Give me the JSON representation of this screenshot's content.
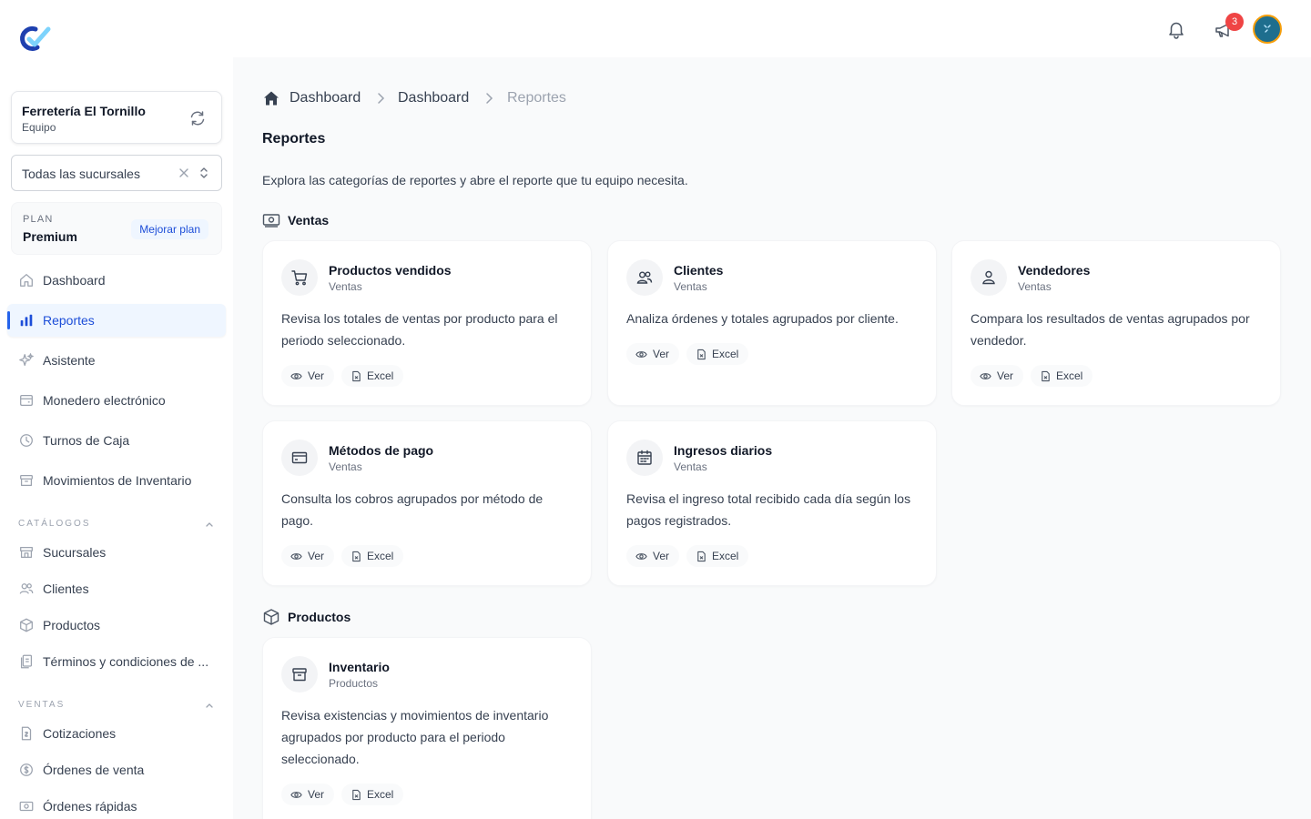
{
  "sidebar": {
    "org": {
      "name": "Ferretería El Tornillo",
      "role": "Equipo"
    },
    "branch": {
      "value": "Todas las sucursales"
    },
    "plan": {
      "label": "PLAN",
      "name": "Premium",
      "upgrade": "Mejorar plan"
    },
    "nav": [
      {
        "label": "Dashboard",
        "icon": "home-icon"
      },
      {
        "label": "Reportes",
        "icon": "bar-chart-icon",
        "active": true
      },
      {
        "label": "Asistente",
        "icon": "sparkles-icon"
      },
      {
        "label": "Monedero electrónico",
        "icon": "wallet-icon"
      },
      {
        "label": "Turnos de Caja",
        "icon": "clock-icon"
      },
      {
        "label": "Movimientos de Inventario",
        "icon": "archive-icon"
      }
    ],
    "sections": [
      {
        "title": "CATÁLOGOS",
        "items": [
          {
            "label": "Sucursales",
            "icon": "store-icon"
          },
          {
            "label": "Clientes",
            "icon": "users-icon"
          },
          {
            "label": "Productos",
            "icon": "cube-icon"
          },
          {
            "label": "Términos y condiciones de ...",
            "icon": "document-icon"
          }
        ]
      },
      {
        "title": "VENTAS",
        "items": [
          {
            "label": "Cotizaciones",
            "icon": "quote-document-icon"
          },
          {
            "label": "Órdenes de venta",
            "icon": "dollar-circle-icon"
          },
          {
            "label": "Órdenes rápidas",
            "icon": "banknote-icon"
          }
        ]
      }
    ]
  },
  "topbar": {
    "notification_count": "3"
  },
  "breadcrumb": [
    "Dashboard",
    "Dashboard",
    "Reportes"
  ],
  "page": {
    "title": "Reportes",
    "description": "Explora las categorías de reportes y abre el reporte que tu equipo necesita."
  },
  "actions": {
    "view": "Ver",
    "excel": "Excel"
  },
  "categories": [
    {
      "name": "Ventas",
      "icon": "banknote-icon",
      "reports": [
        {
          "title": "Productos vendidos",
          "category": "Ventas",
          "description": "Revisa los totales de ventas por producto para el periodo seleccionado.",
          "icon": "cart-icon"
        },
        {
          "title": "Clientes",
          "category": "Ventas",
          "description": "Analiza órdenes y totales agrupados por cliente.",
          "icon": "users-icon"
        },
        {
          "title": "Vendedores",
          "category": "Ventas",
          "description": "Compara los resultados de ventas agrupados por vendedor.",
          "icon": "user-icon"
        },
        {
          "title": "Métodos de pago",
          "category": "Ventas",
          "description": "Consulta los cobros agrupados por método de pago.",
          "icon": "credit-card-icon"
        },
        {
          "title": "Ingresos diarios",
          "category": "Ventas",
          "description": "Revisa el ingreso total recibido cada día según los pagos registrados.",
          "icon": "calendar-icon"
        }
      ]
    },
    {
      "name": "Productos",
      "icon": "cube-icon",
      "reports": [
        {
          "title": "Inventario",
          "category": "Productos",
          "description": "Revisa existencias y movimientos de inventario agrupados por producto para el periodo seleccionado.",
          "icon": "archive-icon"
        }
      ]
    }
  ]
}
